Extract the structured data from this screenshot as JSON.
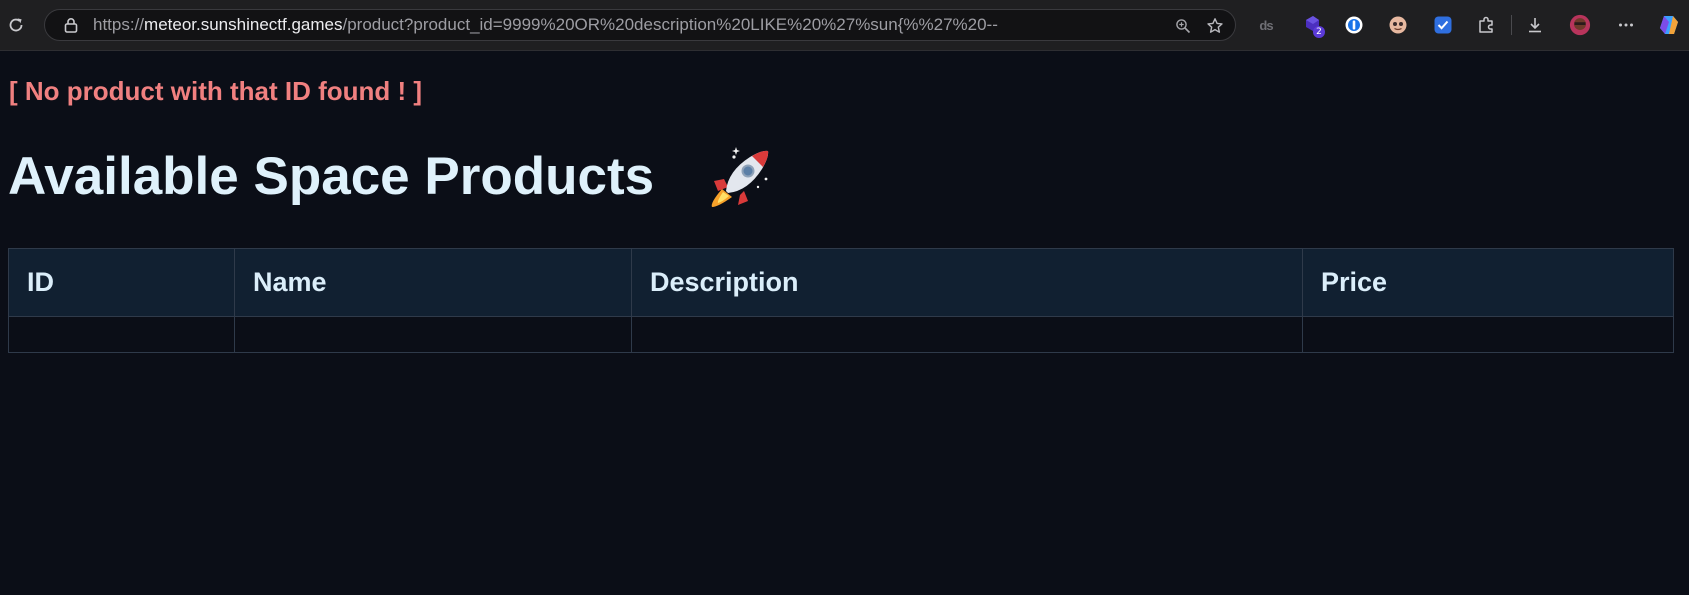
{
  "browser": {
    "url_scheme": "https://",
    "url_host": "meteor.sunshinectf.games",
    "url_path": "/product?product_id=9999%20OR%20description%20LIKE%20%27%sun{%%27%20--",
    "extensions_badge_count": "2",
    "extension_ds_label": "ds"
  },
  "page": {
    "error_message": "[ No product with that ID found ! ]",
    "title": "Available Space Products"
  },
  "table": {
    "headers": [
      "ID",
      "Name",
      "Description",
      "Price"
    ],
    "rows": [
      [
        "",
        "",
        "",
        ""
      ]
    ]
  }
}
